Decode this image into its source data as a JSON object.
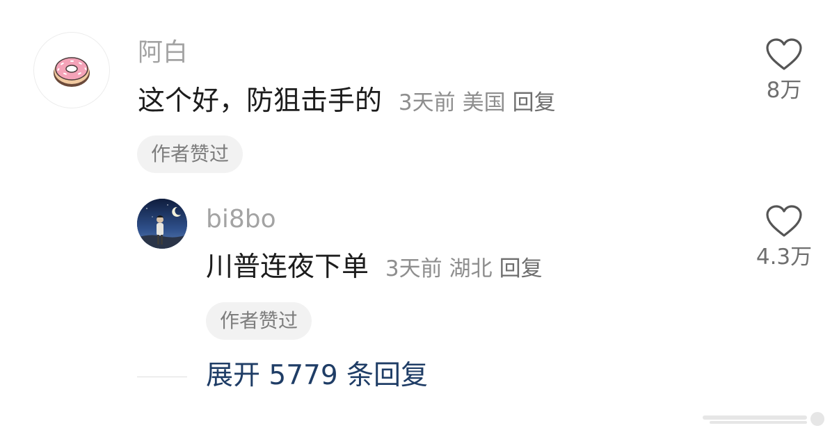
{
  "comment": {
    "username": "阿白",
    "text": "这个好，防狙击手的",
    "time": "3天前",
    "location": "美国",
    "reply_label": "回复",
    "badge": "作者赞过",
    "like_count": "8万",
    "avatar_icon": "donut-icon"
  },
  "reply": {
    "username": "bi8bo",
    "text": "川普连夜下单",
    "time": "3天前",
    "location": "湖北",
    "reply_label": "回复",
    "badge": "作者赞过",
    "like_count": "4.3万",
    "avatar_icon": "night-sky-person-avatar"
  },
  "expand": {
    "label": "展开 5779 条回复"
  },
  "colors": {
    "username": "#a3a3a3",
    "text": "#1c1c1c",
    "meta": "#8e8e8e",
    "badge_bg": "#f2f2f2",
    "expand_link": "#1f3d66",
    "donut_icing": "#f4a3b8"
  }
}
